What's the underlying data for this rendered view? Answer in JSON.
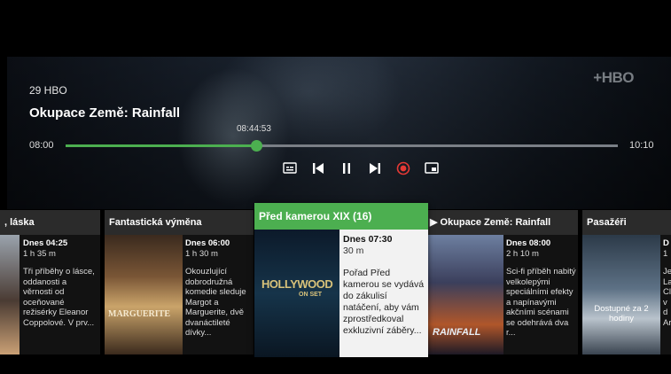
{
  "player": {
    "channel": "29 HBO",
    "title": "Okupace Země: Rainfall",
    "start_time": "08:00",
    "end_time": "10:10",
    "current_time": "08:44:53",
    "progress_fraction": 0.345,
    "logo_text": "HBO",
    "accent_color": "#4caf50"
  },
  "controls": [
    {
      "name": "subtitles-icon"
    },
    {
      "name": "skip-previous-icon"
    },
    {
      "name": "pause-icon"
    },
    {
      "name": "skip-next-icon"
    },
    {
      "name": "record-icon",
      "color": "#e53935"
    },
    {
      "name": "picture-in-picture-icon"
    }
  ],
  "rail": {
    "cards": [
      {
        "title": ", láska",
        "time": "Dnes 04:25",
        "duration": "1 h 35 m",
        "desc": "Tři příběhy o lásce, oddanosti a věrnosti od oceňované režisérky Eleanor Coppolové. V prv..."
      },
      {
        "title": "Fantastická výměna",
        "time": "Dnes 06:00",
        "duration": "1 h 30 m",
        "desc": "Okouzlující dobrodružná komedie sleduje Margot a Marguerite, dvě dvanáctileté dívky..."
      },
      {
        "title": "Před kamerou XIX (16)",
        "time": "Dnes 07:30",
        "duration": "30 m",
        "desc": "Pořad Před kamerou se vydává do zákulisí natáčení, aby vám zprostředkoval exkluzivní záběry..."
      },
      {
        "title": "▶ Okupace Země: Rainfall",
        "time": "Dnes 08:00",
        "duration": "2 h 10 m",
        "desc": "Sci-fi příběh nabitý velkolepými speciálními efekty a napínavými akčními scénami se odehrává dva r..."
      },
      {
        "title": "Pasažéři",
        "time": "D",
        "duration": "1",
        "desc": "Je La Cl v d Ar"
      }
    ],
    "availability": "Dostupné za 2 hodiny",
    "poster_texts": {
      "hollywood": "HOLLYWOOD",
      "hollywood_sub": "ON SET",
      "marguerite": "MARGUERITE",
      "rainfall": "RAINFALL"
    }
  }
}
